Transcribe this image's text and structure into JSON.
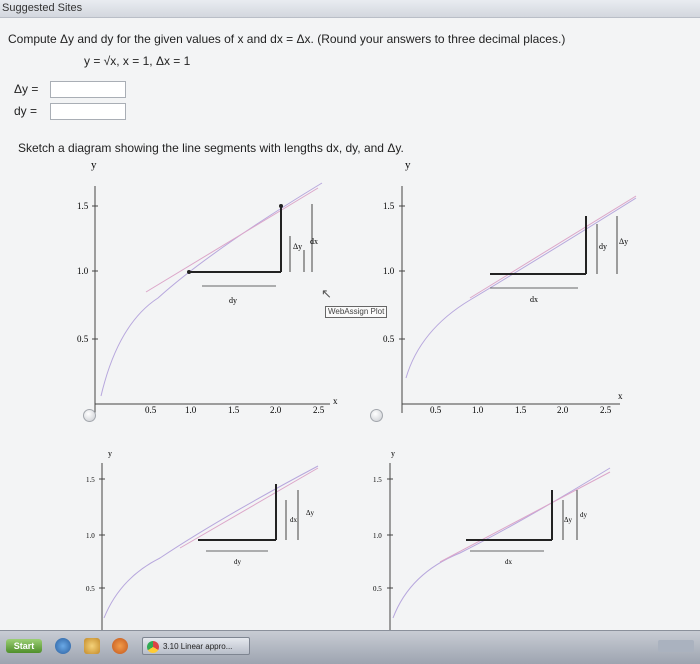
{
  "browser": {
    "bookmarks_label": "Suggested Sites"
  },
  "question": {
    "prompt": "Compute Δy and dy for the given values of x and dx = Δx. (Round your answers to three decimal places.)",
    "equation": "y = √x,  x = 1,  Δx = 1",
    "delta_y_label": "Δy =",
    "dy_label": "dy =",
    "delta_y_value": "",
    "dy_value": "",
    "sketch_prompt": "Sketch a diagram showing the line segments with lengths dx, dy, and Δy."
  },
  "plots": {
    "axis_y_label": "y",
    "axis_x_label": "x",
    "y_ticks": [
      "1.5",
      "1.0",
      "0.5"
    ],
    "x_ticks": [
      "0.5",
      "1.0",
      "1.5",
      "2.0",
      "2.5"
    ],
    "plot_label": "WebAssign Plot",
    "options": [
      {
        "seg_labels": [
          "Δy",
          "dx",
          "dy"
        ]
      },
      {
        "seg_labels": [
          "dy",
          "Δy",
          "dx"
        ]
      },
      {
        "seg_labels": [
          "dx",
          "Δy",
          "dy"
        ]
      },
      {
        "seg_labels": [
          "Δy",
          "dy",
          "dx"
        ]
      }
    ]
  },
  "taskbar": {
    "start_label": "Start",
    "task_label": "3.10 Linear appro..."
  }
}
